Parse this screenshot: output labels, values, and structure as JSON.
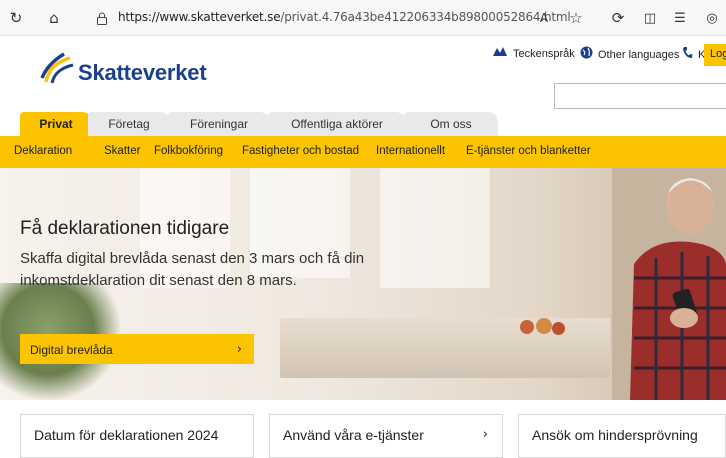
{
  "browser": {
    "back_icon": "↻",
    "home_icon": "⌂",
    "lock_icon": "🔒",
    "url_host": "https://www.skatteverket.se",
    "url_path": "/privat.4.76a43be412206334b89800052864.html",
    "read_aloud_icon": "A",
    "star_icon": "☆",
    "ext_icon": "⟳",
    "split_icon": "◫",
    "fav_icon": "☰",
    "more_icon": "◎"
  },
  "header": {
    "logo_text": "Skatteverket",
    "util_links": [
      {
        "label": "Teckenspråk",
        "icon": "👐"
      },
      {
        "label": "Other languages",
        "icon": "🌐"
      },
      {
        "label": "Kontakta oss",
        "icon": "📞"
      }
    ],
    "login_label": "Log"
  },
  "tabs": [
    "Privat",
    "Företag",
    "Föreningar",
    "Offentliga aktörer",
    "Om oss"
  ],
  "subnav": [
    "Deklaration",
    "Skatter",
    "Folkbokföring",
    "Fastigheter och bostad",
    "Internationellt",
    "E-tjänster och blanketter"
  ],
  "hero": {
    "title": "Få deklarationen tidigare",
    "text": "Skaffa digital brevlåda senast den 3 mars och få din inkomstdeklaration dit senast den 8 mars.",
    "cta_label": "Digital brevlåda"
  },
  "cards": [
    "Datum för deklarationen 2024",
    "Använd våra e-tjänster",
    "Ansök om hindersprövning"
  ],
  "colors": {
    "brand_yellow": "#fcc400",
    "brand_blue": "#1b3f8b"
  }
}
